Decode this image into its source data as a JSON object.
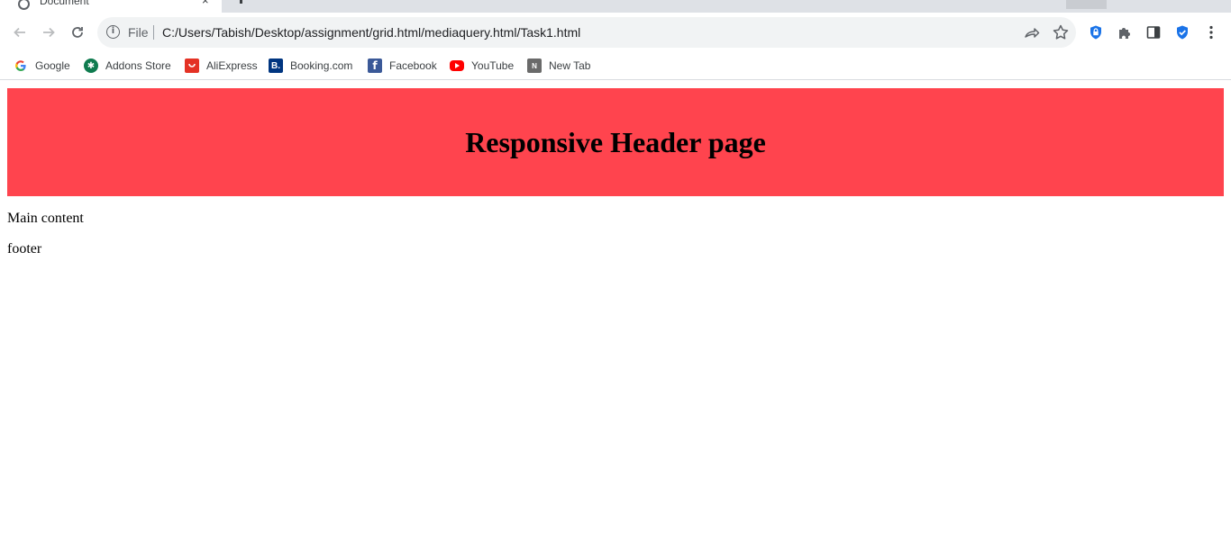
{
  "browser": {
    "tab": {
      "title": "Document",
      "close_glyph": "×"
    },
    "nav": {
      "back_icon": "arrow-left-icon",
      "forward_icon": "arrow-right-icon",
      "reload_icon": "reload-icon"
    },
    "omnibox": {
      "scheme_label": "File",
      "url": "C:/Users/Tabish/Desktop/assignment/grid.html/mediaquery.html/Task1.html"
    },
    "extensions": [
      "shield-lock-icon",
      "puzzle-icon",
      "side-panel-icon",
      "shield-check-icon",
      "kebab-menu-icon"
    ],
    "bookmarks": [
      {
        "label": "Google",
        "icon": "google-icon",
        "color": "#4285f4"
      },
      {
        "label": "Addons Store",
        "icon": "addons-store-icon",
        "color": "#0f7b4f"
      },
      {
        "label": "AliExpress",
        "icon": "aliexpress-icon",
        "color": "#e43225"
      },
      {
        "label": "Booking.com",
        "icon": "booking-icon",
        "color": "#003580",
        "glyph": "B."
      },
      {
        "label": "Facebook",
        "icon": "facebook-icon",
        "color": "#3b5998",
        "glyph": "f"
      },
      {
        "label": "YouTube",
        "icon": "youtube-icon",
        "color": "#ff0000"
      },
      {
        "label": "New Tab",
        "icon": "new-tab-icon",
        "color": "#6a6a6a",
        "glyph": "N"
      }
    ]
  },
  "page": {
    "header_title": "Responsive Header page",
    "header_color": "#ff444e",
    "main_text": "Main content",
    "footer_text": "footer"
  }
}
